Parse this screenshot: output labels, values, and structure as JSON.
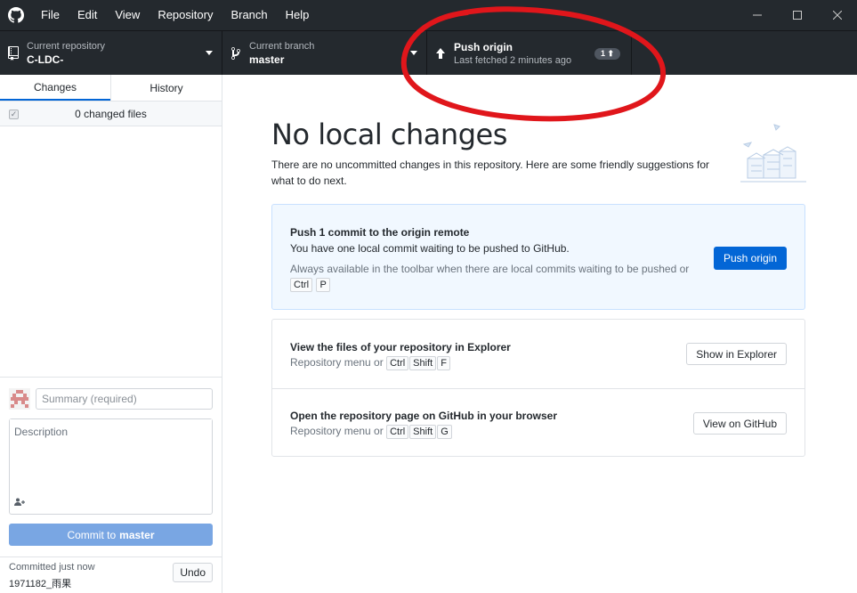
{
  "titlebar": {
    "menu": [
      "File",
      "Edit",
      "View",
      "Repository",
      "Branch",
      "Help"
    ]
  },
  "toolbar": {
    "repo_label": "Current repository",
    "repo_value": "C-LDC-",
    "branch_label": "Current branch",
    "branch_value": "master",
    "push_label": "Push origin",
    "push_sub": "Last fetched 2 minutes ago",
    "push_badge": "1 ⬆"
  },
  "sidebar": {
    "tabs": [
      "Changes",
      "History"
    ],
    "changed_files": "0 changed files",
    "summary_placeholder": "Summary (required)",
    "description_placeholder": "Description",
    "commit_prefix": "Commit to",
    "commit_branch": "master",
    "last_commit_when": "Committed just now",
    "last_commit_msg": "1971182_雨果",
    "undo_label": "Undo"
  },
  "main": {
    "title": "No local changes",
    "subtitle": "There are no uncommitted changes in this repository. Here are some friendly suggestions for what to do next.",
    "push_card": {
      "title": "Push 1 commit to the origin remote",
      "desc": "You have one local commit waiting to be pushed to GitHub.",
      "hint": "Always available in the toolbar when there are local commits waiting to be pushed or",
      "keys": [
        "Ctrl",
        "P"
      ],
      "button": "Push origin"
    },
    "explorer_card": {
      "title": "View the files of your repository in Explorer",
      "hint": "Repository menu or",
      "keys": [
        "Ctrl",
        "Shift",
        "F"
      ],
      "button": "Show in Explorer"
    },
    "github_card": {
      "title": "Open the repository page on GitHub in your browser",
      "hint": "Repository menu or",
      "keys": [
        "Ctrl",
        "Shift",
        "G"
      ],
      "button": "View on GitHub"
    }
  },
  "colors": {
    "chrome": "#24292e",
    "accent": "#0366d6",
    "annotation": "#e0161b"
  }
}
